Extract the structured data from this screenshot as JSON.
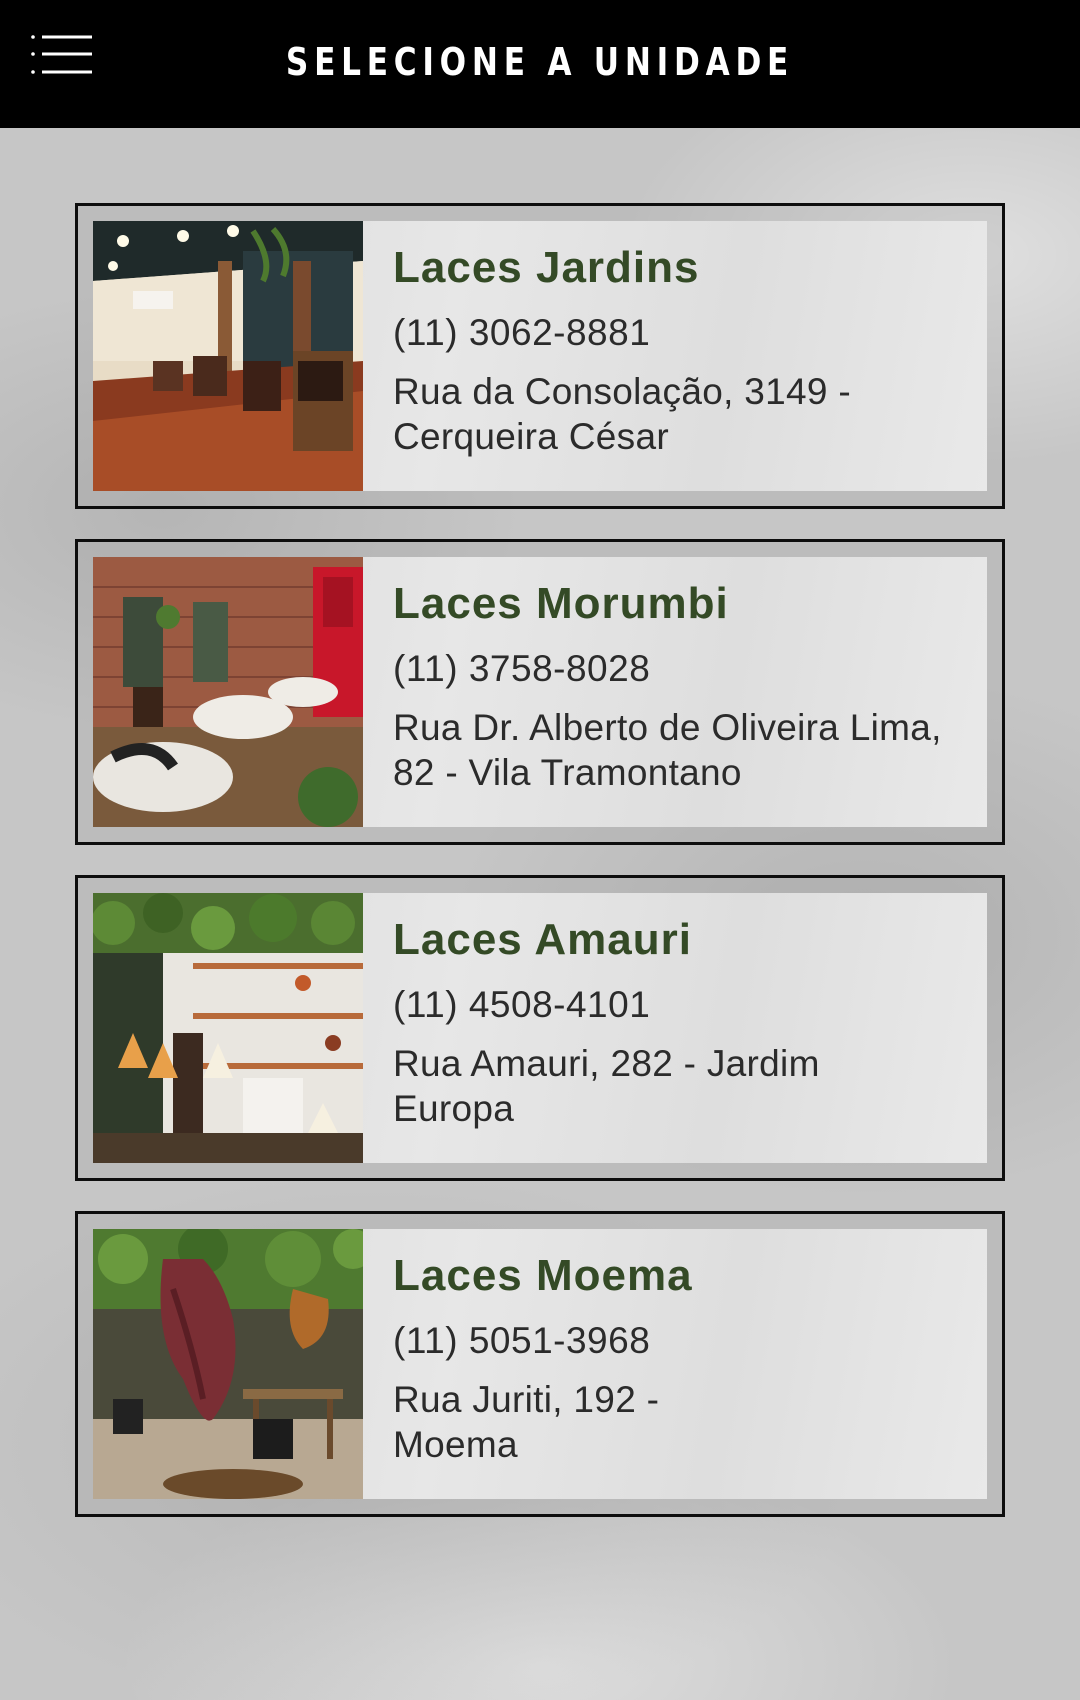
{
  "header": {
    "title": "SELECIONE A UNIDADE",
    "menu_icon": "hamburger-menu-icon",
    "background": "#000000"
  },
  "colors": {
    "unit_name": "#344a26",
    "text": "#2b2b2b",
    "card_border": "#0d0d0d"
  },
  "units": [
    {
      "name": "Laces Jardins",
      "phone": "(11) 3062-8881",
      "address_line1": "Rua da Consolação, 3149 -",
      "address_line2": "Cerqueira César",
      "photo": "salon-interior-photo"
    },
    {
      "name": "Laces Morumbi",
      "phone": "(11) 3758-8028",
      "address_line1": "Rua Dr. Alberto de Oliveira Lima,",
      "address_line2": "82 - Vila Tramontano",
      "photo": "salon-courtyard-photo"
    },
    {
      "name": "Laces Amauri",
      "phone": "(11) 4508-4101",
      "address_line1": "Rua Amauri, 282 - Jardim",
      "address_line2": "Europa",
      "photo": "salon-plants-photo"
    },
    {
      "name": "Laces Moema",
      "phone": "(11) 5051-3968",
      "address_line1": "Rua Juriti, 192 -",
      "address_line2": "Moema",
      "photo": "salon-garden-photo"
    }
  ]
}
